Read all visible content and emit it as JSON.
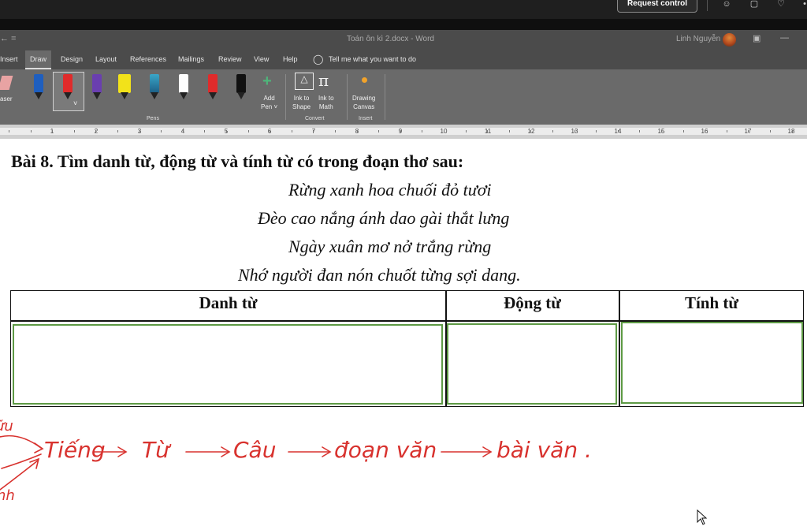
{
  "teams": {
    "request_control": "Request control"
  },
  "word": {
    "quick_access": "← =",
    "doc_title": "Toán ôn kì 2.docx  -  Word",
    "user_name": "Linh Nguyễn",
    "tabs": [
      {
        "label": "Insert"
      },
      {
        "label": "Draw"
      },
      {
        "label": "Design"
      },
      {
        "label": "Layout"
      },
      {
        "label": "References"
      },
      {
        "label": "Mailings"
      },
      {
        "label": "Review"
      },
      {
        "label": "View"
      },
      {
        "label": "Help"
      }
    ],
    "tell_me": "Tell me what you want to do",
    "ribbon": {
      "eraser": "aser",
      "add_pen_1": "Add",
      "add_pen_2": "Pen ˅",
      "ink_to_shape_1": "Ink to",
      "ink_to_shape_2": "Shape",
      "ink_to_math_1": "Ink to",
      "ink_to_math_2": "Math",
      "drawing_canvas_1": "Drawing",
      "drawing_canvas_2": "Canvas",
      "groups": {
        "pens": "Pens",
        "convert": "Convert",
        "insert": "Insert"
      },
      "pen_colors": [
        "#1f5fbf",
        "#e02b2b",
        "#6a3fb0",
        "#f2e21a",
        "#3aa6c8",
        "#ffffff",
        "#e02b2b",
        "#111111"
      ]
    },
    "ruler_numbers": [
      "1",
      "2",
      "3",
      "4",
      "5",
      "6",
      "7",
      "8",
      "9",
      "10",
      "11",
      "12",
      "13",
      "14",
      "15",
      "16",
      "17",
      "18"
    ]
  },
  "document": {
    "heading": "Bài 8. Tìm danh từ, động từ và tính từ có trong đoạn thơ sau:",
    "poem": [
      "Rừng xanh hoa chuối đỏ tươi",
      "Đèo cao nắng ánh dao gài thắt lưng",
      "Ngày xuân mơ nở trắng rừng",
      "Nhớ người đan nón chuốt từng sợi dang."
    ],
    "table_headers": [
      "Danh từ",
      "Động từ",
      "Tính từ"
    ],
    "handwriting": {
      "left_fragment_1": "ữu",
      "left_fragment_2": "nh",
      "chain": [
        "Tiếng",
        "Từ",
        "Câu",
        "đoạn văn",
        "bài văn ."
      ],
      "ink_color": "#d8322e"
    }
  }
}
